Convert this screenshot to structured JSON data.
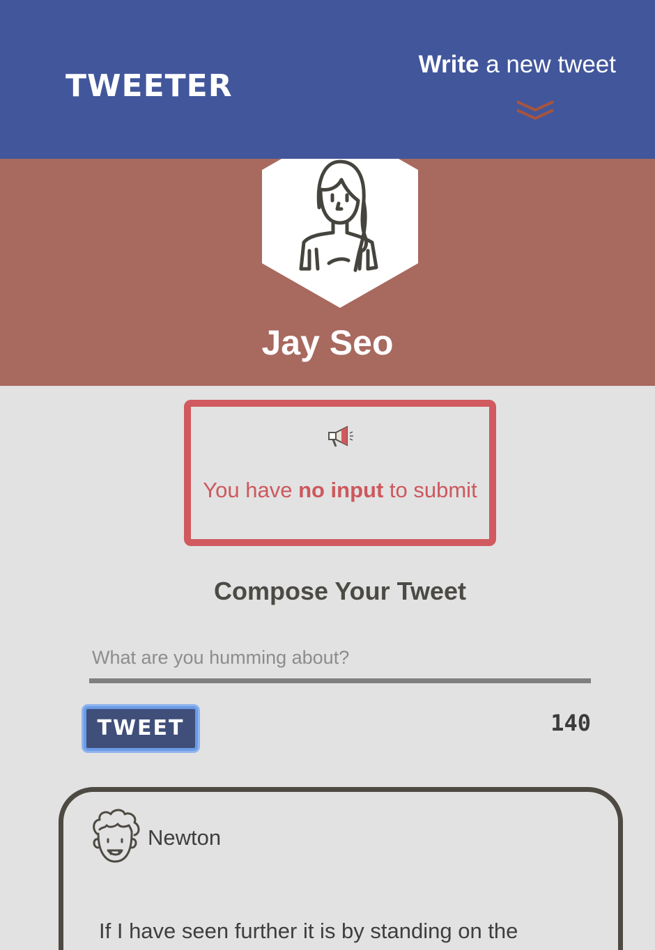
{
  "nav": {
    "brand": "TWEETER",
    "compose_toggle_bold": "Write",
    "compose_toggle_rest": " a new tweet",
    "chevron_icon": "double-chevron-down-icon"
  },
  "profile": {
    "name": "Jay Seo",
    "avatar_icon": "woman-avatar-icon"
  },
  "error": {
    "icon": "megaphone-icon",
    "text_before": "You have ",
    "text_bold": "no input",
    "text_after": " to submit"
  },
  "composer": {
    "title": "Compose Your Tweet",
    "placeholder": "What are you humming about?",
    "value": "",
    "button_label": "TWEET",
    "char_count": "140"
  },
  "tweets": [
    {
      "author": "Newton",
      "avatar_icon": "curly-hair-man-avatar-icon",
      "content": "If I have seen further it is by standing on the shoulders of giants"
    }
  ],
  "colors": {
    "nav_bg": "#42569b",
    "profile_bg": "#a8695f",
    "page_bg": "#e2e2e2",
    "error": "#d05a5f",
    "chevron": "#a5553f",
    "button_bg": "#3f4f79"
  }
}
